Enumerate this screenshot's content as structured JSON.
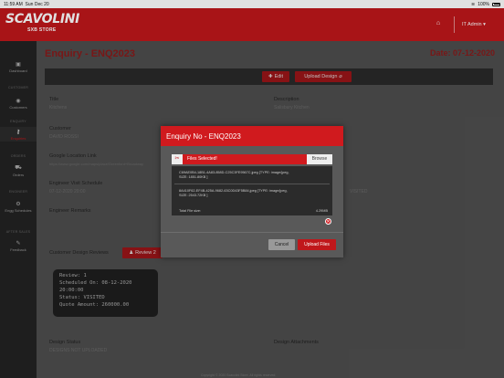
{
  "status_bar": {
    "time": "11:59 AM",
    "date": "Sun Dec 20",
    "battery": "100%"
  },
  "brand": {
    "name": "SCAVOLINI",
    "sub": "SXB STORE"
  },
  "topbar": {
    "user": "IT Admin"
  },
  "sidebar": {
    "items": [
      {
        "label": "Dashboard",
        "icon": "dashboard-icon"
      },
      {
        "section": "CUSTOMER"
      },
      {
        "label": "Customers",
        "icon": "eye-icon"
      },
      {
        "section": "ENQUIRY"
      },
      {
        "label": "Enquiries",
        "icon": "key-icon",
        "active": true
      },
      {
        "section": "ORDERS"
      },
      {
        "label": "Orders",
        "icon": "cart-icon"
      },
      {
        "section": "ENGINEER"
      },
      {
        "label": "Engg Schedules",
        "icon": "gear-icon"
      },
      {
        "section": "AFTER SALES"
      },
      {
        "label": "Feedback",
        "icon": "feedback-icon"
      }
    ]
  },
  "page": {
    "title": "Enquiry - ENQ2023",
    "date": "Date: 07-12-2020",
    "actions": {
      "edit": "Edit",
      "upload_design": "Upload Design"
    },
    "fields": {
      "title_label": "Title",
      "title_value": "Kitchens",
      "description_label": "Description",
      "description_value": "Salisbury Kitchen",
      "customer_label": "Customer",
      "customer_value": "DAVID ROSSI",
      "location_label": "Google Location Link",
      "location_value": "https://www.google.com/maps/place/Greenford+Broadway",
      "schedule_label": "Engineer Visit Schedule",
      "schedule_value": "07-12-2020 20:00",
      "status_value": "VISITED",
      "remarks_label": "Engineer Remarks",
      "design_review_label": "Customer Design Reviews",
      "review_button": "Review 2",
      "design_status_label": "Design Status",
      "design_status_value": "DESIGNS NOT UPLOADED",
      "design_attachments_label": "Design Attachments"
    },
    "review_card": {
      "line1": "Review: 1",
      "line2": "Scheduled On: 08-12-2020",
      "line3": "20:00:00",
      "line4": "Status: VISITED",
      "line5": "Quote Amount: 260000.00"
    },
    "footer": "Copyright © 2020 Scavolini Store. All rights reserved."
  },
  "modal": {
    "title": "Enquiry No - ENQ2023",
    "files_selected": "Files Selected!",
    "browse": "Browse",
    "files": [
      {
        "line1": "C69AE0B4-18B1-4A83-858D-C25C3FE9567C.jpeg [TYPE: image/jpeg,",
        "line2": "SIZE: 1851.80KB ]"
      },
      {
        "line1": "8A410F62-EF4B-425A-9682-63C0D43F5B84.jpeg [TYPE: image/jpeg,",
        "line2": "SIZE: 2543.72KB ]"
      }
    ],
    "total_label": "Total File size:",
    "total_value": "4.29MB",
    "cancel": "Cancel",
    "upload": "Upload Files"
  }
}
